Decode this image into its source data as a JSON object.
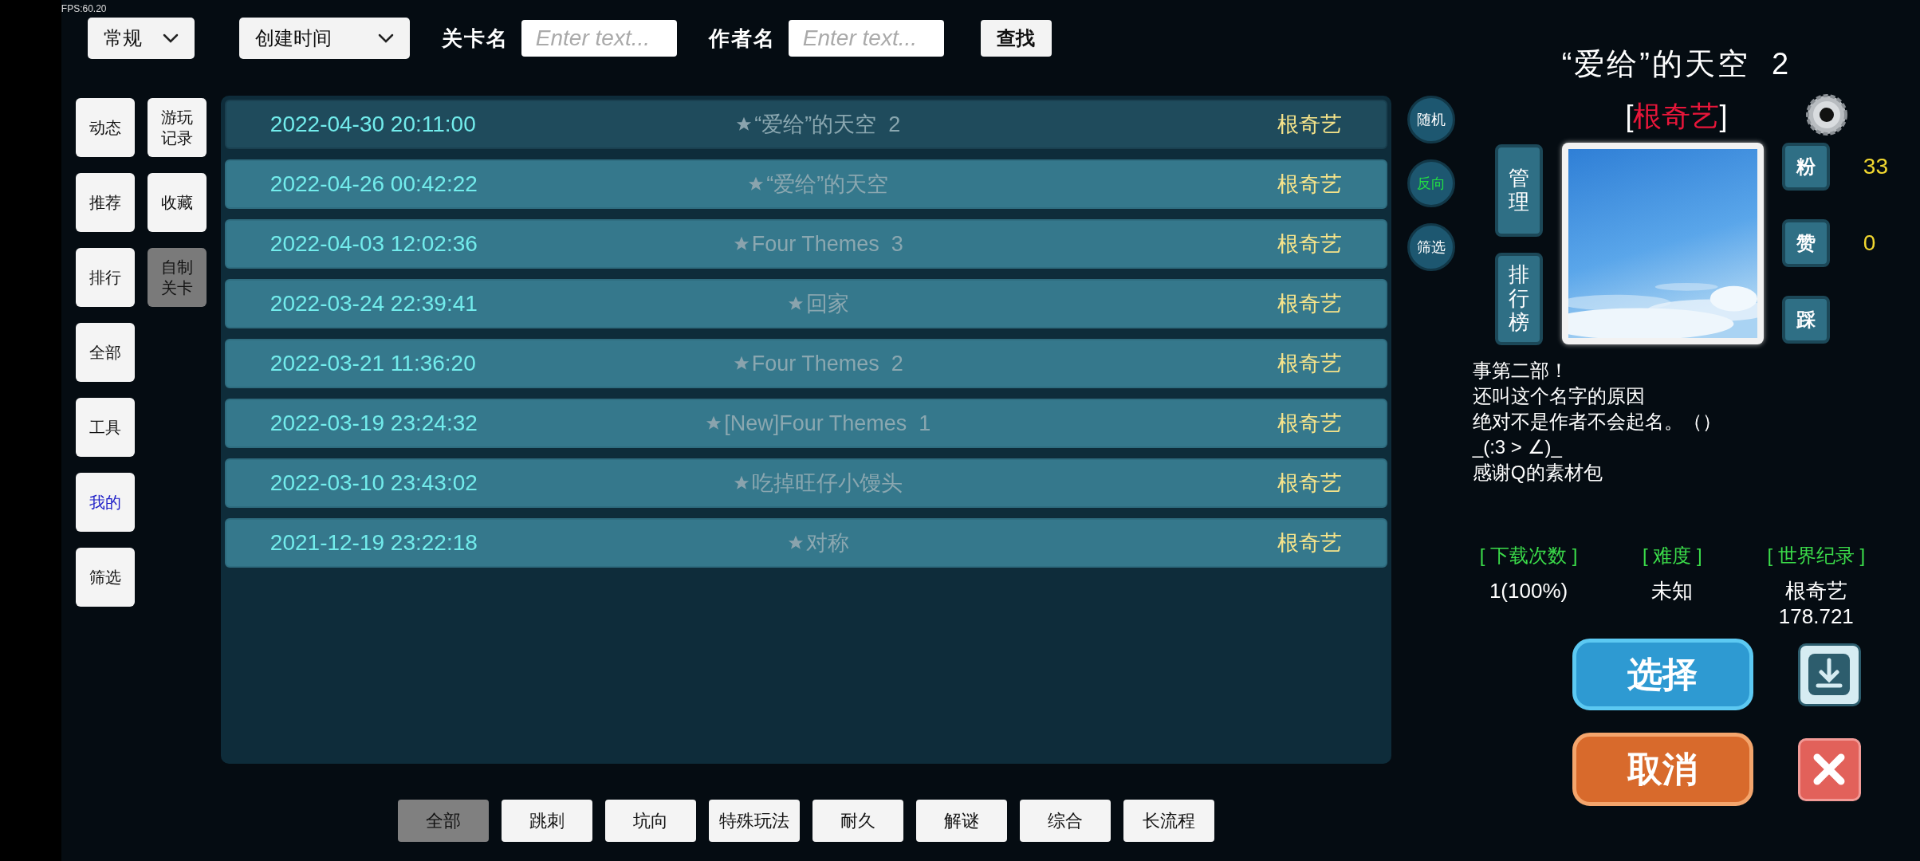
{
  "fps": "FPS:60.20",
  "toolbar": {
    "dropdowns": [
      {
        "value": "常规"
      },
      {
        "value": "创建时间"
      }
    ],
    "fields": [
      {
        "label": "关卡名",
        "placeholder": "Enter text..."
      },
      {
        "label": "作者名",
        "placeholder": "Enter text..."
      }
    ],
    "search_button": "查找"
  },
  "nav": {
    "columns": [
      [
        {
          "label": "动态",
          "selected": false,
          "highlighted": false
        },
        {
          "label": "推荐",
          "selected": false,
          "highlighted": false
        },
        {
          "label": "排行",
          "selected": false,
          "highlighted": false
        },
        {
          "label": "全部",
          "selected": false,
          "highlighted": false
        },
        {
          "label": "工具",
          "selected": false,
          "highlighted": false
        },
        {
          "label": "我的",
          "selected": false,
          "highlighted": true
        },
        {
          "label": "筛选",
          "selected": false,
          "highlighted": false
        }
      ],
      [
        {
          "label": "游玩记录",
          "selected": false,
          "highlighted": false
        },
        {
          "label": "收藏",
          "selected": false,
          "highlighted": false
        },
        {
          "label": "自制关卡",
          "selected": true,
          "highlighted": false
        }
      ]
    ]
  },
  "levels": [
    {
      "date": "2022-04-30 20:11:00",
      "title": "“爱给”的天空  2",
      "author": "根奇艺",
      "selected": true
    },
    {
      "date": "2022-04-26 00:42:22",
      "title": "“爱给”的天空",
      "author": "根奇艺",
      "selected": false
    },
    {
      "date": "2022-04-03 12:02:36",
      "title": "Four Themes  3",
      "author": "根奇艺",
      "selected": false
    },
    {
      "date": "2022-03-24 22:39:41",
      "title": "回家",
      "author": "根奇艺",
      "selected": false
    },
    {
      "date": "2022-03-21 11:36:20",
      "title": "Four Themes  2",
      "author": "根奇艺",
      "selected": false
    },
    {
      "date": "2022-03-19 23:24:32",
      "title": "[New]Four Themes  1",
      "author": "根奇艺",
      "selected": false
    },
    {
      "date": "2022-03-10 23:43:02",
      "title": "吃掉旺仔小馒头",
      "author": "根奇艺",
      "selected": false
    },
    {
      "date": "2021-12-19 23:22:18",
      "title": "对称",
      "author": "根奇艺",
      "selected": false
    }
  ],
  "side_buttons": [
    {
      "label": "随机",
      "on": false
    },
    {
      "label": "反向",
      "on": true
    },
    {
      "label": "筛选",
      "on": false
    }
  ],
  "detail": {
    "title": "“爱给”的天空  2",
    "author": {
      "open": "[",
      "name": "根奇艺",
      "close": "]"
    },
    "side_actions": [
      {
        "label": "管理"
      },
      {
        "label": "排行榜"
      }
    ],
    "reactions": [
      {
        "label": "粉",
        "count": "33"
      },
      {
        "label": "赞",
        "count": "0"
      },
      {
        "label": "踩"
      }
    ],
    "description": [
      "事第二部！",
      "还叫这个名字的原因",
      "绝对不是作者不会起名。（）",
      "_(:3 > ∠)_",
      "感谢Q的素材包"
    ],
    "stats": [
      {
        "label": "[ 下载次数 ]",
        "lines": [
          "1(100%)"
        ]
      },
      {
        "label": "[ 难度 ]",
        "lines": [
          "未知"
        ]
      },
      {
        "label": "[ 世界纪录 ]",
        "lines": [
          "根奇艺",
          "178.721"
        ]
      }
    ],
    "select_button": "选择",
    "cancel_button": "取消"
  },
  "categories": [
    {
      "label": "全部",
      "selected": true
    },
    {
      "label": "跳刺",
      "selected": false
    },
    {
      "label": "坑向",
      "selected": false
    },
    {
      "label": "特殊玩法",
      "selected": false
    },
    {
      "label": "耐久",
      "selected": false
    },
    {
      "label": "解谜",
      "selected": false
    },
    {
      "label": "综合",
      "selected": false
    },
    {
      "label": "长流程",
      "selected": false
    }
  ]
}
